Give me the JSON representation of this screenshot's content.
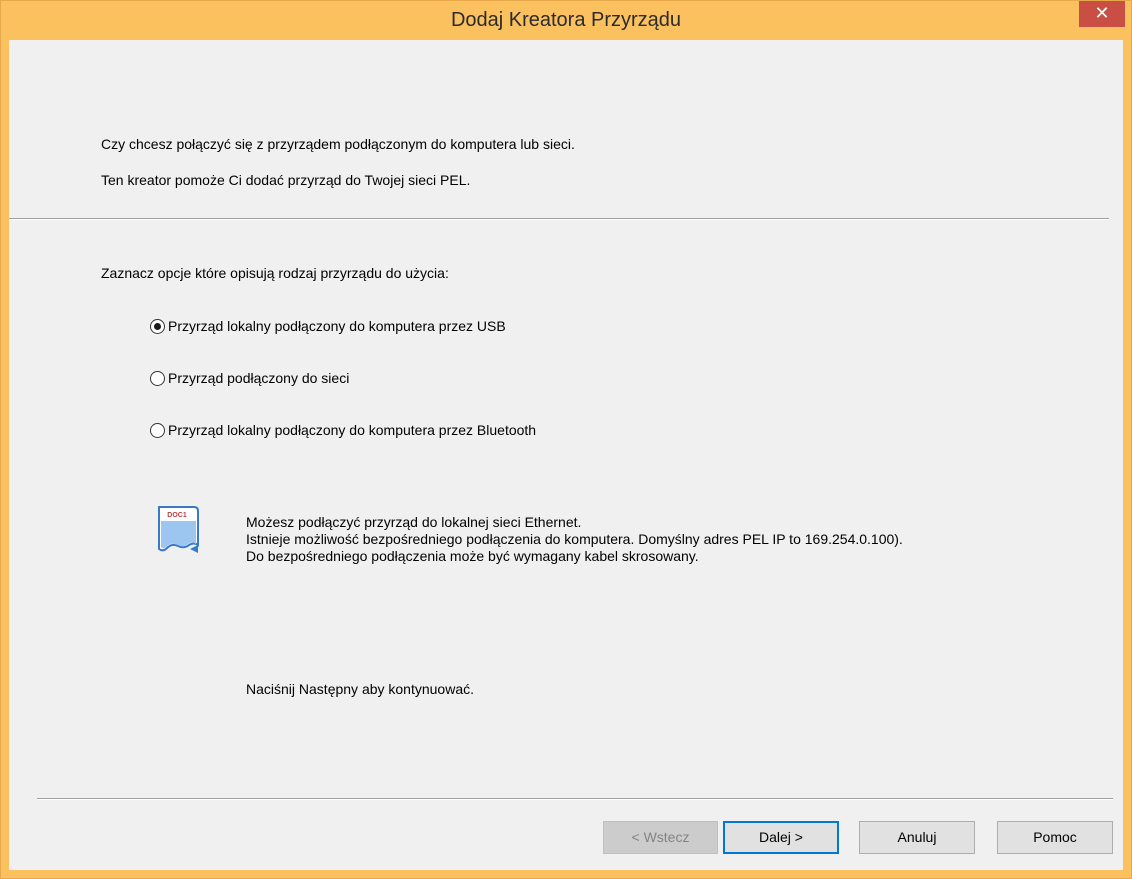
{
  "window": {
    "title": "Dodaj Kreatora Przyrządu",
    "close_symbol": "✕"
  },
  "intro": {
    "line1": "Czy chcesz połączyć się z przyrządem podłączonym do komputera lub sieci.",
    "line2": "Ten kreator pomoże Ci dodać przyrząd do Twojej sieci PEL."
  },
  "options": {
    "prompt": "Zaznacz opcje które opisują rodzaj przyrządu do użycia:",
    "items": [
      {
        "label": "Przyrząd lokalny podłączony do komputera przez USB",
        "checked": true
      },
      {
        "label": "Przyrząd podłączony do sieci",
        "checked": false
      },
      {
        "label": "Przyrząd lokalny podłączony do komputera przez Bluetooth",
        "checked": false
      }
    ]
  },
  "info": {
    "icon": "document-icon",
    "icon_text": "DOC1",
    "line1": "Możesz podłączyć przyrząd do lokalnej sieci Ethernet.",
    "line2": "Istnieje możliwość bezpośredniego podłączenia do komputera. Domyślny adres PEL IP to 169.254.0.100).",
    "line3": "Do bezpośredniego podłączenia może być wymagany kabel skrosowany."
  },
  "continue_hint": "Naciśnij Następny aby kontynuować.",
  "buttons": {
    "back": "< Wstecz",
    "next": "Dalej >",
    "cancel": "Anuluj",
    "help": "Pomoc"
  },
  "colors": {
    "titlebar": "#fbc15f",
    "close": "#c94e43",
    "client": "#f0f0f0"
  }
}
